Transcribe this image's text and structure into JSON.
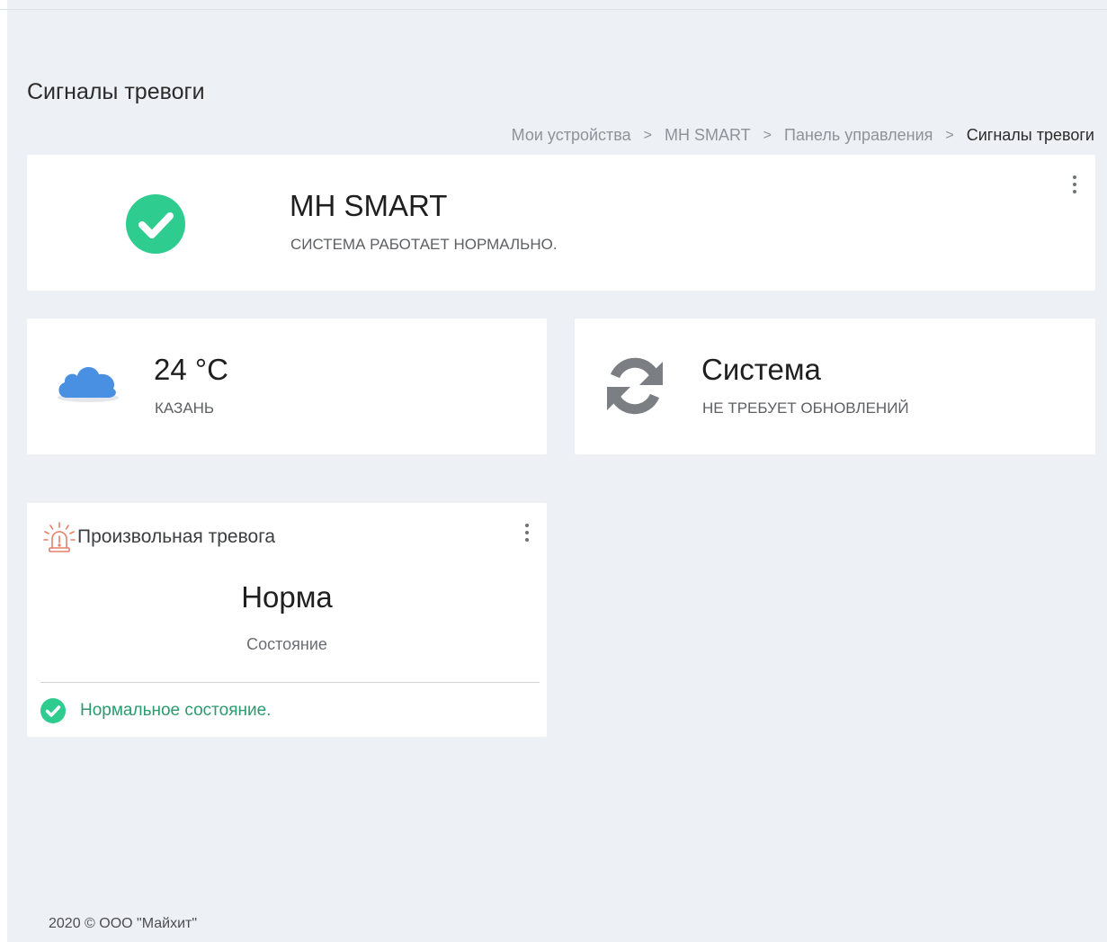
{
  "page": {
    "title": "Сигналы тревоги",
    "breadcrumb": [
      {
        "label": "Мои устройства"
      },
      {
        "label": "MH SMART"
      },
      {
        "label": "Панель управления"
      },
      {
        "label": "Сигналы тревоги"
      }
    ],
    "breadcrumb_separator": ">"
  },
  "device": {
    "name": "MH SMART",
    "status": "СИСТЕМА РАБОТАЕТ НОРМАЛЬНО.",
    "status_icon": "check-circle-icon",
    "status_color": "#2ecc8e"
  },
  "weather": {
    "temperature": "24 °C",
    "city": "КАЗАНЬ",
    "icon": "cloud-icon",
    "icon_color": "#4a90e2"
  },
  "system": {
    "title": "Система",
    "subtitle": "НЕ ТРЕБУЕТ ОБНОВЛЕНИЙ",
    "icon": "sync-icon",
    "icon_color": "#7b7f84"
  },
  "alarm": {
    "title": "Произвольная тревога",
    "icon": "siren-icon",
    "icon_color": "#e57e6a",
    "state": "Норма",
    "state_label": "Состояние",
    "footer_text": "Нормальное состояние.",
    "footer_icon": "check-circle-icon",
    "footer_color": "#2c9a6f"
  },
  "footer": {
    "copyright": "2020 © ООО \"Майхит\""
  }
}
